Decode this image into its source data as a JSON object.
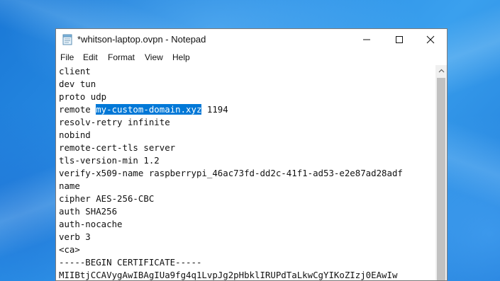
{
  "window": {
    "title": "*whitson-laptop.ovpn - Notepad"
  },
  "menu": {
    "file": "File",
    "edit": "Edit",
    "format": "Format",
    "view": "View",
    "help": "Help"
  },
  "editor": {
    "lines": [
      "client",
      "dev tun",
      "proto udp",
      "remote ",
      "resolv-retry infinite",
      "nobind",
      "remote-cert-tls server",
      "tls-version-min 1.2",
      "verify-x509-name raspberrypi_46ac73fd-dd2c-41f1-ad53-e2e87ad28adf",
      "name",
      "cipher AES-256-CBC",
      "auth SHA256",
      "auth-nocache",
      "verb 3",
      "<ca>",
      "-----BEGIN CERTIFICATE-----",
      "MIIBtjCCAVygAwIBAgIUa9fg4q1LvpJg2pHbklIRUPdTaLkwCgYIKoZIzj0EAwIw"
    ],
    "selected_text": "my-custom-domain.xyz",
    "after_selection": " 1194"
  },
  "colors": {
    "selection": "#0078d7",
    "desktop": "#1a78d6"
  }
}
